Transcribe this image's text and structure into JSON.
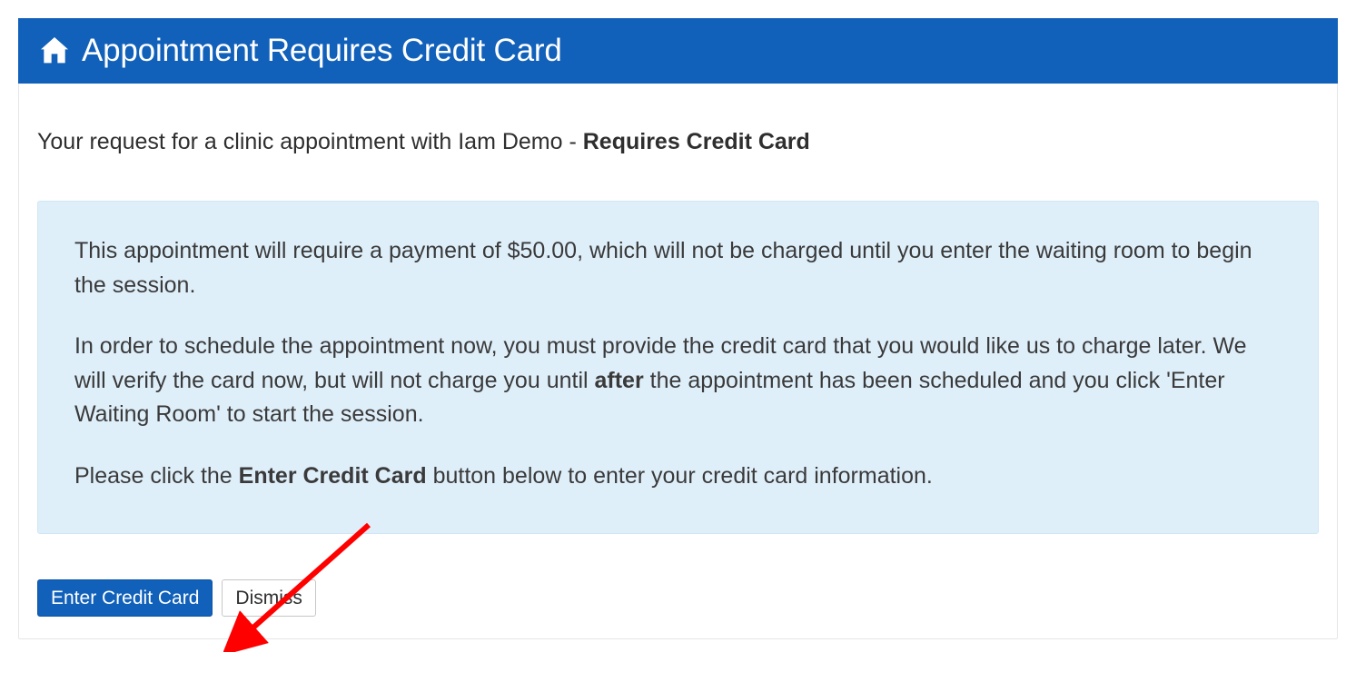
{
  "header": {
    "icon": "home-icon",
    "title": "Appointment Requires Credit Card"
  },
  "body": {
    "lead_prefix": "Your request for a clinic appointment with Iam Demo - ",
    "lead_bold": "Requires Credit Card"
  },
  "info": {
    "p1": "This appointment will require a payment of $50.00, which will not be charged until you enter the waiting room to begin the session.",
    "p2_before": "In order to schedule the appointment now, you must provide the credit card that you would like us to charge later. We will verify the card now, but will not charge you until ",
    "p2_bold": "after",
    "p2_after": " the appointment has been scheduled and you click 'Enter Waiting Room' to start the session.",
    "p3_before": "Please click the ",
    "p3_bold": "Enter Credit Card",
    "p3_after": " button below to enter your credit card information."
  },
  "buttons": {
    "primary": "Enter Credit Card",
    "dismiss": "Dismiss"
  }
}
